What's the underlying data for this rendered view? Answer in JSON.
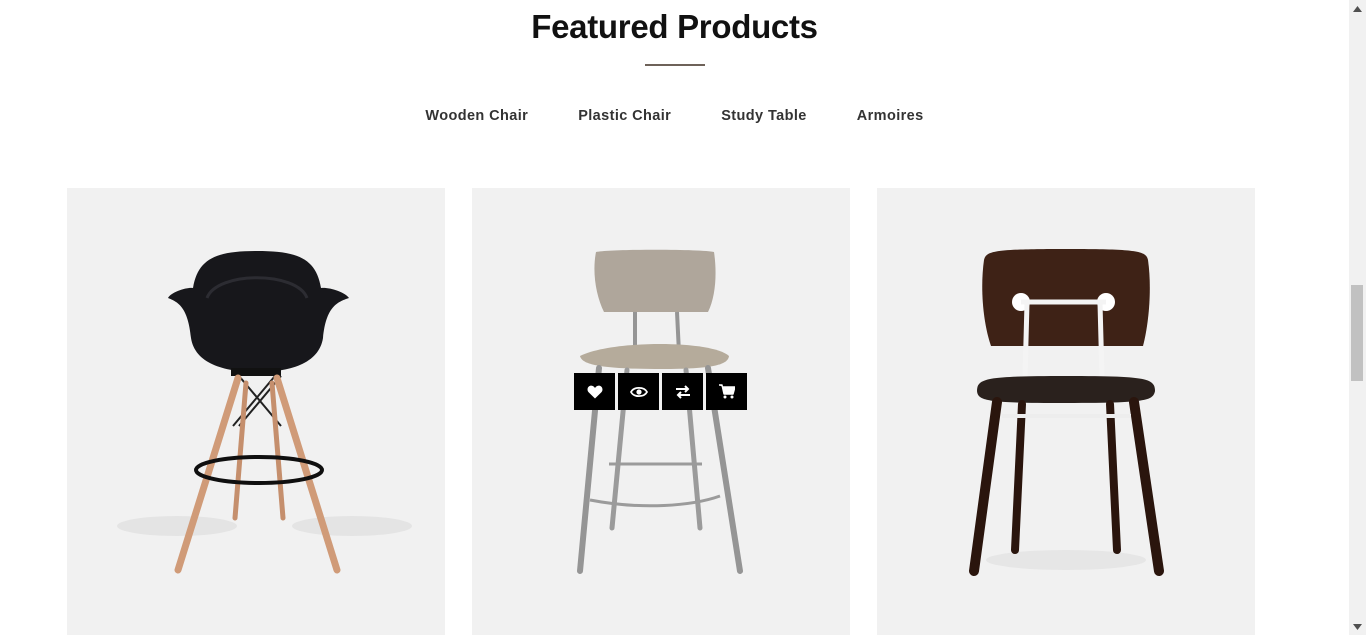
{
  "section": {
    "title": "Featured Products"
  },
  "tabs": [
    {
      "label": "Wooden Chair"
    },
    {
      "label": "Plastic Chair"
    },
    {
      "label": "Study Table"
    },
    {
      "label": "Armoires"
    }
  ],
  "products": [
    {
      "image": "black-plastic-armchair-stool"
    },
    {
      "image": "walnut-bar-stool",
      "hovered": true
    },
    {
      "image": "dark-wood-chair-white-frame"
    }
  ],
  "actions": [
    {
      "icon": "heart-icon"
    },
    {
      "icon": "eye-icon"
    },
    {
      "icon": "compare-icon"
    },
    {
      "icon": "cart-icon"
    }
  ],
  "colors": {
    "card_background": "#f1f1f1",
    "action_background": "#000000",
    "title_rule": "#6e6259"
  }
}
